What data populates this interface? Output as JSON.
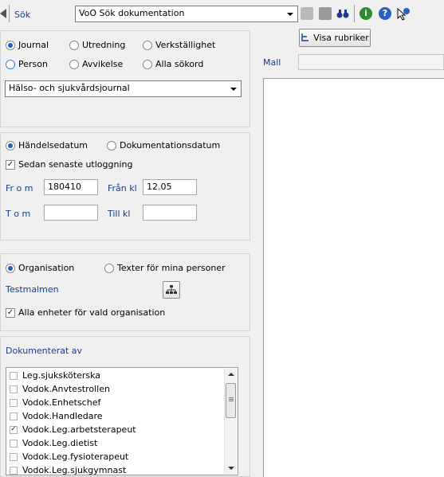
{
  "toolbar": {
    "search_label": "Sök",
    "combo_value": "VoO Sök dokumentation",
    "icons": [
      "print-preview-icon",
      "print-icon",
      "binoculars-icon",
      "info-icon",
      "help-icon",
      "whats-this-icon"
    ]
  },
  "journal_type": {
    "options": [
      "Journal",
      "Utredning",
      "Verkställighet",
      "Person",
      "Avvikelse",
      "Alla sökord"
    ],
    "selected": "Journal",
    "dropdown_value": "Hälso- och sjukvårdsjournal"
  },
  "date": {
    "options": [
      "Händelsedatum",
      "Dokumentationsdatum"
    ],
    "selected": "Händelsedatum",
    "since_logout_label": "Sedan senaste utloggning",
    "since_logout_checked": true,
    "from_label": "Fr o m",
    "from_value": "180410",
    "from_time_label": "Från kl",
    "from_time_value": "12.05",
    "to_label": "T o m",
    "to_value": "",
    "to_time_label": "Till kl",
    "to_time_value": ""
  },
  "organisation": {
    "options": [
      "Organisation",
      "Texter för mina personer"
    ],
    "selected": "Organisation",
    "org_name": "Testmalmen",
    "all_units_label": "Alla enheter för vald organisation",
    "all_units_checked": true
  },
  "documented_by": {
    "title": "Dokumenterat av",
    "items": [
      {
        "label": "Leg.sjuksköterska",
        "checked": false
      },
      {
        "label": "Vodok.Anvtestrollen",
        "checked": false
      },
      {
        "label": "Vodok.Enhetschef",
        "checked": false
      },
      {
        "label": "Vodok.Handledare",
        "checked": false
      },
      {
        "label": "Vodok.Leg.arbetsterapeut",
        "checked": true
      },
      {
        "label": "Vodok.Leg.dietist",
        "checked": false
      },
      {
        "label": "Vodok.Leg.fysioterapeut",
        "checked": false
      },
      {
        "label": "Vodok.Leg.sjukgymnast",
        "checked": false
      }
    ]
  },
  "right": {
    "show_headers_label": "Visa rubriker",
    "mall_label": "Mall",
    "mall_value": ""
  },
  "colors": {
    "accent": "#1f5fb4",
    "label_blue": "#1a3c8c"
  }
}
